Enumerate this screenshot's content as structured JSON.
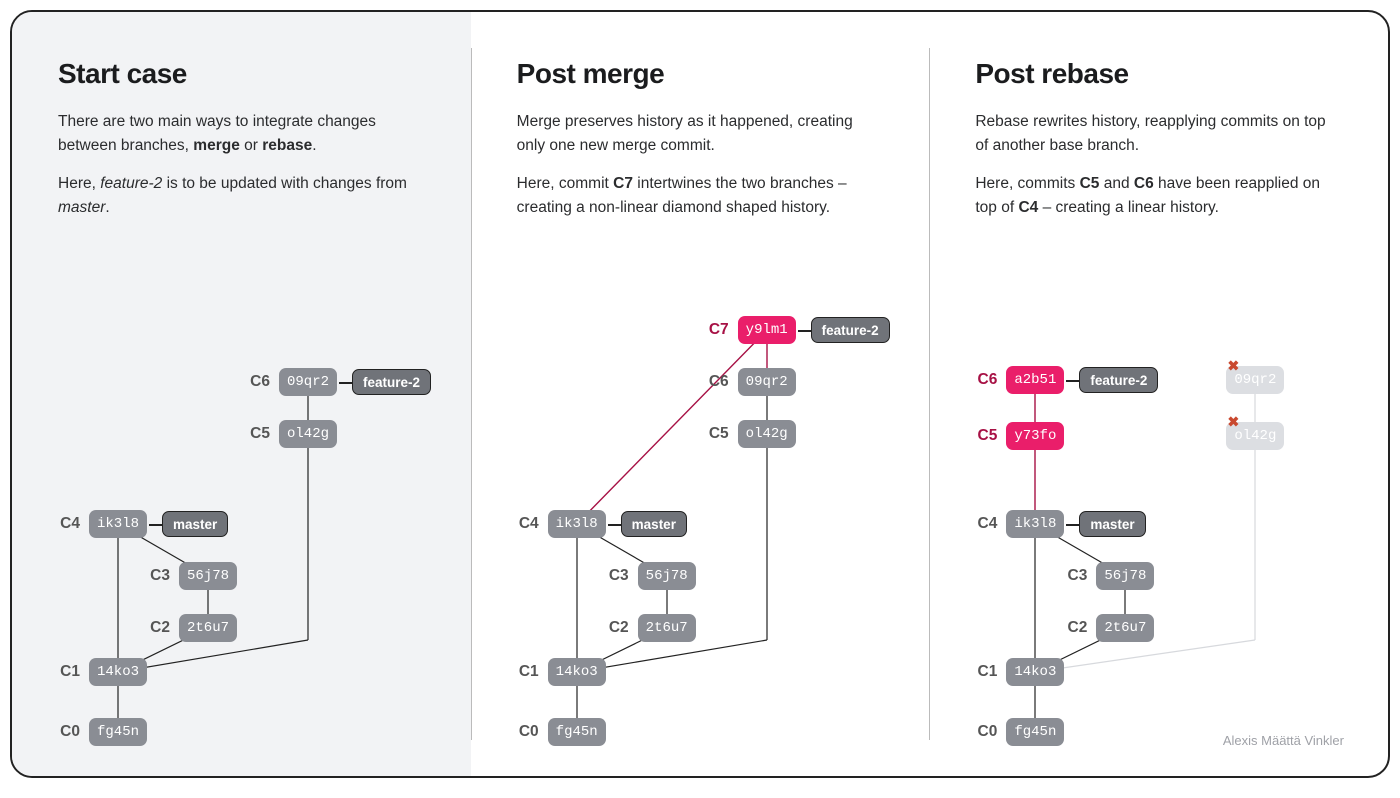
{
  "attribution": "Alexis Määttä Vinkler",
  "columns": {
    "start": {
      "title": "Start case",
      "p1": "There are two main ways to integrate changes between branches, <b>merge</b> or <b>rebase</b>.",
      "p2": "Here, <i>feature-2</i> is to be updated with changes from <i>master</i>.",
      "commits": [
        {
          "id": "c0",
          "label": "C0",
          "hash": "fg45n"
        },
        {
          "id": "c1",
          "label": "C1",
          "hash": "14ko3"
        },
        {
          "id": "c2",
          "label": "C2",
          "hash": "2t6u7"
        },
        {
          "id": "c3",
          "label": "C3",
          "hash": "56j78"
        },
        {
          "id": "c4",
          "label": "C4",
          "hash": "ik3l8",
          "branch": "master"
        },
        {
          "id": "c5",
          "label": "C5",
          "hash": "ol42g"
        },
        {
          "id": "c6",
          "label": "C6",
          "hash": "09qr2",
          "branch": "feature-2"
        }
      ]
    },
    "merge": {
      "title": "Post merge",
      "p1": "Merge preserves history as it happened, creating only one new merge commit.",
      "p2": "Here, commit <b>C7</b> intertwines the two branches – creating a non-linear diamond shaped history.",
      "commits": [
        {
          "id": "c0",
          "label": "C0",
          "hash": "fg45n"
        },
        {
          "id": "c1",
          "label": "C1",
          "hash": "14ko3"
        },
        {
          "id": "c2",
          "label": "C2",
          "hash": "2t6u7"
        },
        {
          "id": "c3",
          "label": "C3",
          "hash": "56j78"
        },
        {
          "id": "c4",
          "label": "C4",
          "hash": "ik3l8",
          "branch": "master"
        },
        {
          "id": "c5",
          "label": "C5",
          "hash": "ol42g"
        },
        {
          "id": "c6",
          "label": "C6",
          "hash": "09qr2"
        },
        {
          "id": "c7",
          "label": "C7",
          "hash": "y9lm1",
          "branch": "feature-2",
          "new": true
        }
      ]
    },
    "rebase": {
      "title": "Post rebase",
      "p1": "Rebase rewrites history, reapplying commits on top of another base branch.",
      "p2": "Here, commits <b>C5</b> and <b>C6</b> have been reapplied on top of <b>C4</b> – creating a linear history.",
      "commits": [
        {
          "id": "c0",
          "label": "C0",
          "hash": "fg45n"
        },
        {
          "id": "c1",
          "label": "C1",
          "hash": "14ko3"
        },
        {
          "id": "c2",
          "label": "C2",
          "hash": "2t6u7"
        },
        {
          "id": "c3",
          "label": "C3",
          "hash": "56j78"
        },
        {
          "id": "c4",
          "label": "C4",
          "hash": "ik3l8",
          "branch": "master"
        },
        {
          "id": "c5n",
          "label": "C5",
          "hash": "y73fo",
          "new": true
        },
        {
          "id": "c6n",
          "label": "C6",
          "hash": "a2b51",
          "branch": "feature-2",
          "new": true
        },
        {
          "id": "c5g",
          "hash": "ol42g",
          "ghost": true
        },
        {
          "id": "c6g",
          "hash": "09qr2",
          "ghost": true
        }
      ]
    }
  },
  "colors": {
    "commit_gray": "#8a8d94",
    "commit_pink": "#ea1e6a",
    "ghost": "#dcdee2",
    "edge": "#222",
    "edge_pink": "#a71145",
    "edge_ghost": "#d7d9dd"
  }
}
